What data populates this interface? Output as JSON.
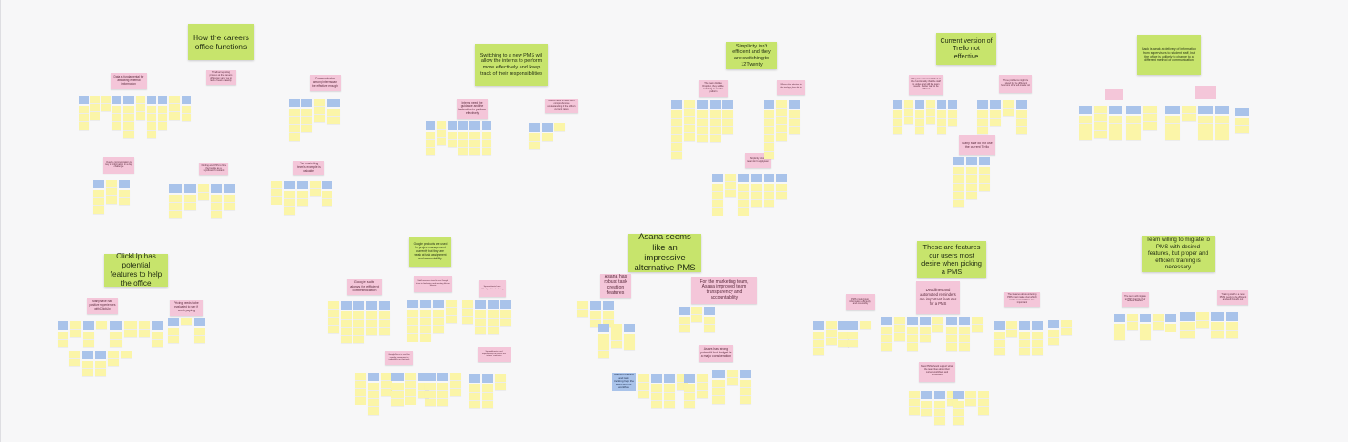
{
  "colors": {
    "background": "#f7f7f8",
    "header_note": "#c7e46c",
    "insight_note": "#f4c6d9",
    "category_note": "#a9c3ea",
    "observation_note": "#fbf5a8"
  },
  "clusters": [
    {
      "header": "How the careers office functions",
      "insights": [
        "Data is fundamental for attracting external information",
        "The final reporting process at the careers office can vary due to lack of team capacity",
        "Communication among interns can be effective enough",
        "Quality communication is key to information in a day challenge",
        "Finding and PMS to hire the budget as a significant constraint",
        "The marketing team's example is valuable"
      ]
    },
    {
      "header": "Switching to a new PMS will allow the interns to perform more effectively and keep track of their responsibilities",
      "insights": [
        "Interns need the guidance and the instruction to perform effectively",
        "Interns need to have some comprehensive understanding of the office's current status"
      ]
    },
    {
      "header": "Simplicity isn't efficient and they are switching to 12Twenty",
      "insights": [
        "The team dislikes Dropbox, they will be switching to another platform",
        "Whether the attention to the interface has a lot to do with the user",
        "Simplicity shows team don't apply lean"
      ]
    },
    {
      "header": "Current version of Trello not effective",
      "insights": [
        "They have tried and failed at the functionality that the staff is under, and still the team needs a better way to be efficient",
        "These problems might be solved by the different functions of a well-made tool",
        "Many staff do not use the current Trello"
      ]
    },
    {
      "header": "Back is weak at delivery of information from supervisors to student staff, but the office is unlikely to change to a different method of communication",
      "insights": []
    },
    {
      "header": "ClickUp has potential features to help the office",
      "insights": [
        "Many have had positive experiences with ClickUp",
        "Pricing needs to be evaluated to see if worth paying"
      ]
    },
    {
      "header": "Google products are used for project management currently but they are weak at task assignment and accountability",
      "insights": [
        "Google suite allows for efficient communication",
        "Staff members tend to use Google Drive to find notes and meeting files on Sheets",
        "Spreadsheets have difficulty with task sharing",
        "Google Docs is used for sending comments to individuals on their task",
        "Spreadsheets need improvement to reduce the interns' confusion"
      ]
    },
    {
      "header": "Asana seems like an impressive alternative PMS",
      "insights": [
        "Asana has robust task creation features",
        "For the marketing team, Asana improved team transparency and accountability",
        "Asana has strong potential but budget is a major consideration"
      ],
      "category_note": "Asana's timeline and task tracking help the team with its workflow"
    },
    {
      "header": "These are features our users most desire when picking a PMS",
      "insights": [
        "PMS should store information efficiently and accessibly",
        "Deadlines and automated reminders are important features for a PMS",
        "The features about ordering PMS must make clear which tasks and workflows are important",
        "New PMS should support what the team likes about their current workflows and processes"
      ]
    },
    {
      "header": "Team willing to migrate to PMS with desired features, but proper and efficient training is necessary",
      "insights": [
        "The team will migrate to PMS that fits their desired features",
        "Training staff on a new PMS needs to be efficient and well thought out"
      ]
    }
  ]
}
